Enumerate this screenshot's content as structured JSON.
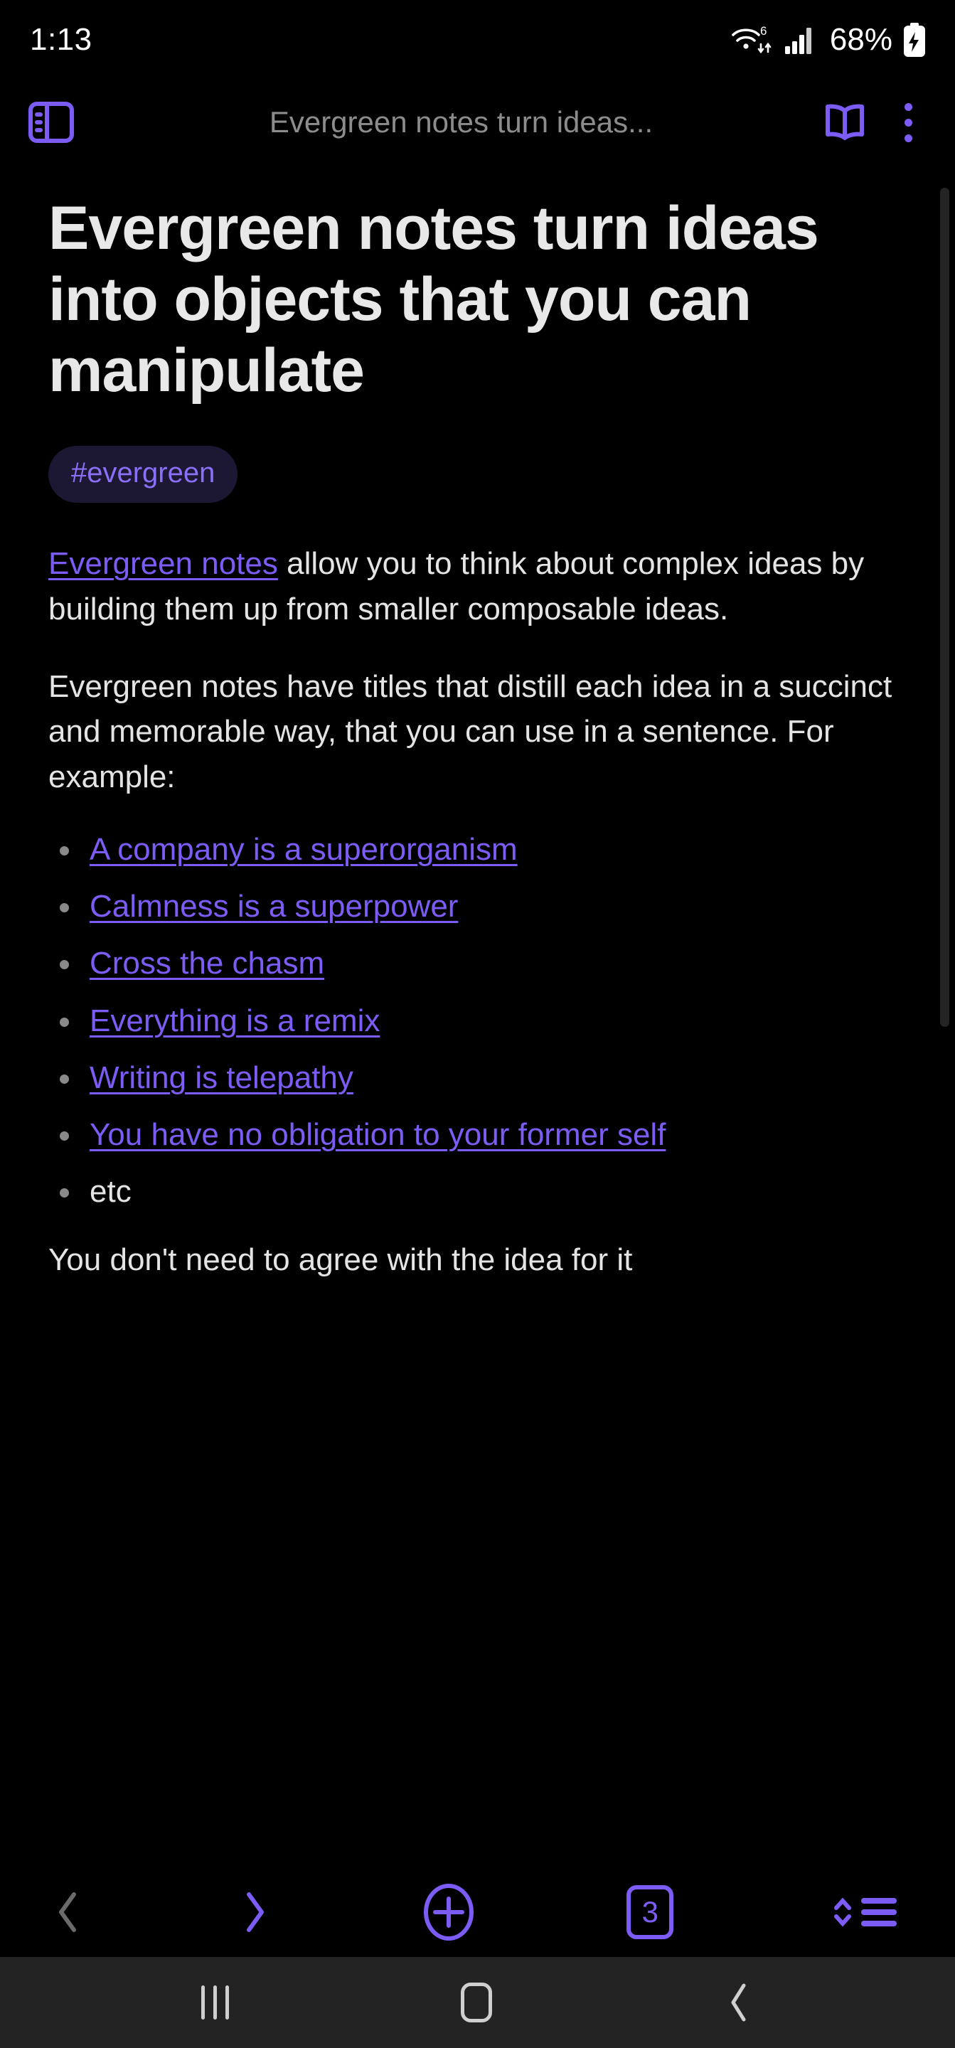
{
  "status_bar": {
    "time": "1:13",
    "wifi_icon": "wifi-6-icon",
    "signal_icon": "cellular-signal-icon",
    "battery_percent": "68%",
    "battery_icon": "battery-charging-icon"
  },
  "app_bar": {
    "sidebar_icon": "sidebar-panel-icon",
    "title": "Evergreen notes turn ideas...",
    "reading_mode_icon": "open-book-icon",
    "overflow_icon": "kebab-menu-icon"
  },
  "note": {
    "title": "Evergreen notes turn ideas into objects that you can manipulate",
    "tag": "#evergreen",
    "paragraph_1": {
      "link_text": "Evergreen notes",
      "rest": " allow you to think about complex ideas by building them up from smaller composable ideas."
    },
    "paragraph_2": "Evergreen notes have titles that distill each idea in a succinct and memorable way, that you can use in a sentence. For example:",
    "examples": [
      {
        "text": "A company is a superorganism",
        "is_link": true
      },
      {
        "text": "Calmness is a superpower",
        "is_link": true
      },
      {
        "text": "Cross the chasm",
        "is_link": true
      },
      {
        "text": "Everything is a remix",
        "is_link": true
      },
      {
        "text": "Writing is telepathy",
        "is_link": true
      },
      {
        "text": "You have no obligation to your former self",
        "is_link": true
      },
      {
        "text": "etc",
        "is_link": false
      }
    ],
    "paragraph_3_partial": "You don't need to agree with the idea for it"
  },
  "bottom_bar": {
    "back_icon": "chevron-left-icon",
    "forward_icon": "chevron-right-icon",
    "new_note_icon": "plus-circle-icon",
    "tab_count": "3",
    "sort_icon": "sort-list-icon"
  },
  "nav_bar": {
    "recents_icon": "recents-icon",
    "home_icon": "home-icon",
    "back_icon": "android-back-icon"
  },
  "colors": {
    "background": "#000000",
    "accent_purple": "#7c5cf5",
    "link_purple": "#7c5cf5",
    "tag_background": "#1c1733",
    "text_primary": "#e4e4e4",
    "text_muted": "#8c8c8c",
    "nav_bar_background": "#232323",
    "disabled_gray": "#6b6b6b"
  }
}
